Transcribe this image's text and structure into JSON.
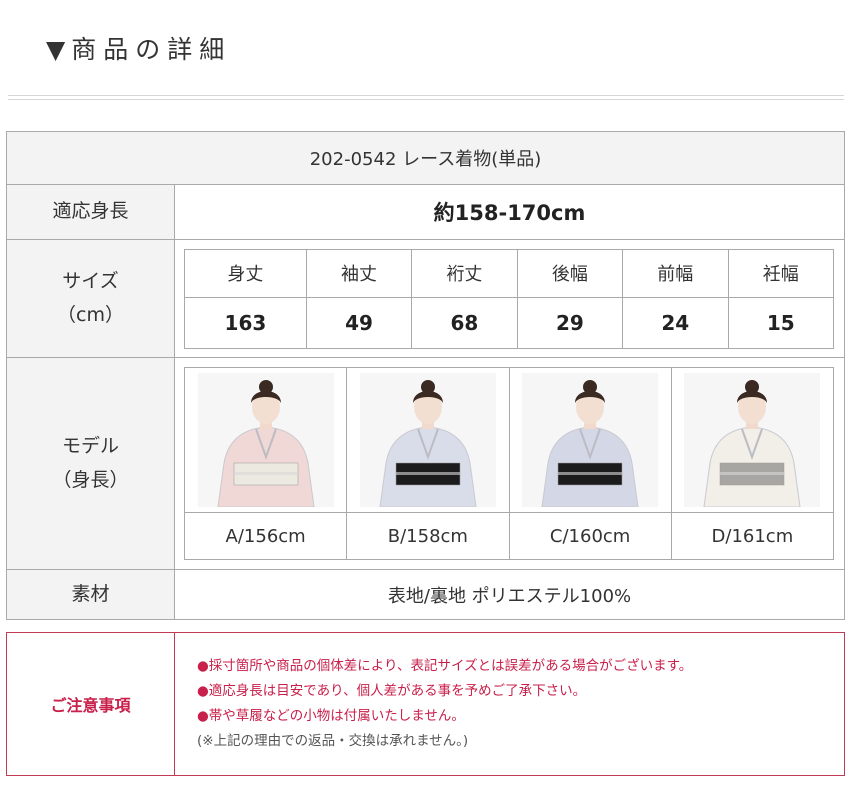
{
  "heading": {
    "marker": "▼",
    "text": "商品の詳細"
  },
  "product": {
    "title": "202-0542 レース着物(単品)"
  },
  "fit_height": {
    "label": "適応身長",
    "value": "約158-170cm"
  },
  "size": {
    "label_line1": "サイズ",
    "label_line2": "（cm）",
    "columns": [
      {
        "name": "身丈",
        "value": "163"
      },
      {
        "name": "袖丈",
        "value": "49"
      },
      {
        "name": "裄丈",
        "value": "68"
      },
      {
        "name": "後幅",
        "value": "29"
      },
      {
        "name": "前幅",
        "value": "24"
      },
      {
        "name": "衽幅",
        "value": "15"
      }
    ]
  },
  "model": {
    "label_line1": "モデル",
    "label_line2": "（身長）",
    "items": [
      {
        "caption": "A/156cm",
        "kimono_color": "#f0d8d6",
        "obi_color": "#ece9e0"
      },
      {
        "caption": "B/158cm",
        "kimono_color": "#d9dde9",
        "obi_color": "#1c1c1c"
      },
      {
        "caption": "C/160cm",
        "kimono_color": "#d4d7e6",
        "obi_color": "#1c1c1c"
      },
      {
        "caption": "D/161cm",
        "kimono_color": "#f1efe8",
        "obi_color": "#a8a6a2"
      }
    ]
  },
  "material": {
    "label": "素材",
    "value": "表地/裏地 ポリエステル100%"
  },
  "notice": {
    "label": "ご注意事項",
    "lines": [
      "●採寸箇所や商品の個体差により、表記サイズとは誤差がある場合がございます。",
      "●適応身長は目安であり、個人差がある事を予めご了承下さい。",
      "●帯や草履などの小物は付属いたしません。",
      "(※上記の理由での返品・交換は承れません。)"
    ]
  },
  "colors": {
    "accent": "#c8204a",
    "border": "#a9a9a9",
    "label_bg": "#f3f3f3"
  }
}
